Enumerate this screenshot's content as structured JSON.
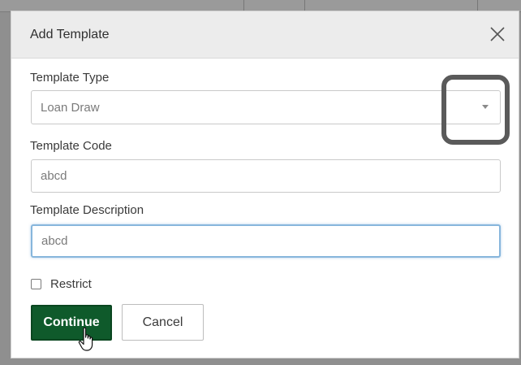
{
  "modal": {
    "title": "Add Template",
    "close_icon": "close-icon"
  },
  "fields": {
    "template_type": {
      "label": "Template Type",
      "value": "Loan Draw"
    },
    "template_code": {
      "label": "Template Code",
      "value": "abcd"
    },
    "template_description": {
      "label": "Template Description",
      "value": "abcd"
    }
  },
  "restrict": {
    "label": "Restrict",
    "checked": false
  },
  "buttons": {
    "continue_label": "Continue",
    "cancel_label": "Cancel"
  },
  "colors": {
    "primary": "#0f5a2b",
    "focus_border": "#87b6dc",
    "highlight": "#5a5a5a"
  }
}
